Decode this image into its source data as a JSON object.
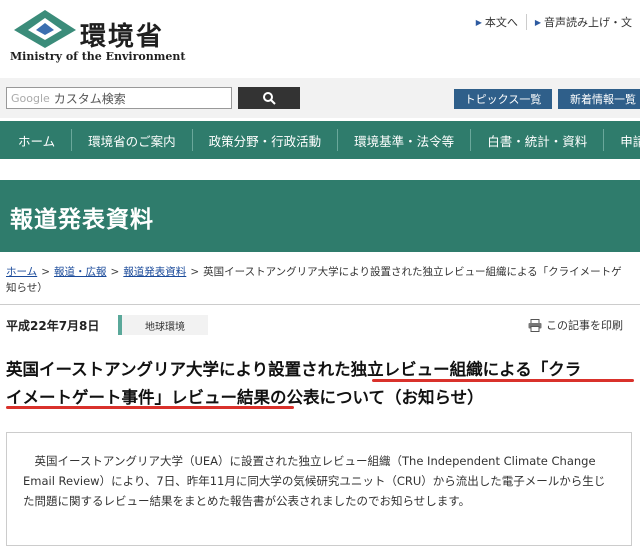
{
  "header": {
    "logo_jp": "環境省",
    "logo_en": "Ministry of the Environment",
    "util_links": [
      "本文へ",
      "音声読み上げ・文"
    ]
  },
  "search": {
    "google_word": "Google",
    "placeholder": "カスタム検索"
  },
  "buttons": {
    "topics": "トピックス一覧",
    "news": "新着情報一覧"
  },
  "nav": {
    "items": [
      "ホーム",
      "環境省のご案内",
      "政策分野・行政活動",
      "環境基準・法令等",
      "白書・統計・資料",
      "申請"
    ]
  },
  "banner": {
    "title": "報道発表資料"
  },
  "breadcrumb": {
    "links": [
      "ホーム",
      "報道・広報",
      "報道発表資料"
    ],
    "current": "英国イーストアングリア大学により設置された独立レビュー組織による「クライメートゲ",
    "current_cont": "知らせ）",
    "separator": ">"
  },
  "article": {
    "date": "平成22年7月8日",
    "category": "地球環境",
    "print_label": "この記事を印刷",
    "headline_line1": "英国イーストアングリア大学により設置された独立レビュー組織による「クラ",
    "headline_line2": "イメートゲート事件」レビュー結果の公表について（お知らせ）",
    "body": "英国イーストアングリア大学（UEA）に設置された独立レビュー組織（The Independent Climate Change Email Review）により、7日、昨年11月に同大学の気候研究ユニット（CRU）から流出した電子メールから生じた問題に関するレビュー結果をまとめた報告書が公表されましたのでお知らせします。"
  },
  "colors": {
    "green": "#2f7c6c",
    "blue_button": "#2f5f8a",
    "highlight_red": "#d9312b"
  }
}
